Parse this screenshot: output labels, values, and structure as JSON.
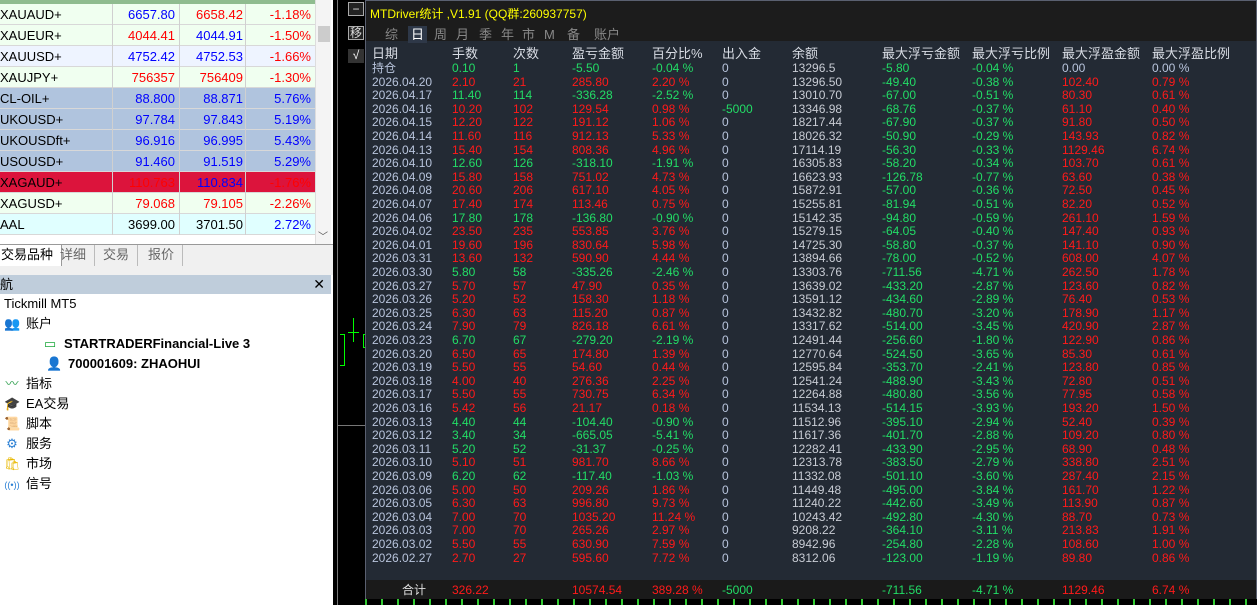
{
  "colors": {
    "profit": "#ff1a1a",
    "loss": "#22dd66",
    "neutral": "#b8c4dc",
    "balance": "#c8ccd4",
    "title": "#ffff00",
    "bid_up": "#0000ff",
    "bid_down": "#ff0000"
  },
  "market_watch": {
    "rows": [
      {
        "symbol": "XAUAUD+",
        "bid": "6657.80",
        "ask": "6658.42",
        "change": "-1.18%",
        "bg": "#f0fff0",
        "bid_color": "#0000ff",
        "ask_color": "#ff0000",
        "chg_color": "#ff0000"
      },
      {
        "symbol": "XAUEUR+",
        "bid": "4044.41",
        "ask": "4044.91",
        "change": "-1.50%",
        "bg": "#f0fff0",
        "bid_color": "#ff0000",
        "ask_color": "#0000ff",
        "chg_color": "#ff0000"
      },
      {
        "symbol": "XAUUSD+",
        "bid": "4752.42",
        "ask": "4752.53",
        "change": "-1.66%",
        "bg": "#eef4ff",
        "bid_color": "#0000ff",
        "ask_color": "#0000ff",
        "chg_color": "#ff0000"
      },
      {
        "symbol": "XAUJPY+",
        "bid": "756357",
        "ask": "756409",
        "change": "-1.30%",
        "bg": "#f0fff0",
        "bid_color": "#ff0000",
        "ask_color": "#ff0000",
        "chg_color": "#ff0000"
      },
      {
        "symbol": "CL-OIL+",
        "bid": "88.800",
        "ask": "88.871",
        "change": "5.76%",
        "bg": "#b0c4de",
        "bid_color": "#0000ff",
        "ask_color": "#0000ff",
        "chg_color": "#0000ff"
      },
      {
        "symbol": "UKOUSD+",
        "bid": "97.784",
        "ask": "97.843",
        "change": "5.19%",
        "bg": "#b0c4de",
        "bid_color": "#0000ff",
        "ask_color": "#0000ff",
        "chg_color": "#0000ff"
      },
      {
        "symbol": "UKOUSDft+",
        "bid": "96.916",
        "ask": "96.995",
        "change": "5.43%",
        "bg": "#b0c4de",
        "bid_color": "#0000ff",
        "ask_color": "#0000ff",
        "chg_color": "#0000ff"
      },
      {
        "symbol": "USOUSD+",
        "bid": "91.460",
        "ask": "91.519",
        "change": "5.29%",
        "bg": "#b0c4de",
        "bid_color": "#0000ff",
        "ask_color": "#0000ff",
        "chg_color": "#0000ff"
      },
      {
        "symbol": "XAGAUD+",
        "bid": "110.763",
        "ask": "110.834",
        "change": "-1.76%",
        "bg": "#dc143c",
        "bid_color": "#ff0000",
        "ask_color": "#0000ff",
        "chg_color": "#ff0000"
      },
      {
        "symbol": "XAGUSD+",
        "bid": "79.068",
        "ask": "79.105",
        "change": "-2.26%",
        "bg": "#f0fff0",
        "bid_color": "#ff0000",
        "ask_color": "#ff0000",
        "chg_color": "#ff0000"
      },
      {
        "symbol": "AAL",
        "bid": "3699.00",
        "ask": "3701.50",
        "change": "2.72%",
        "bg": "#e0ffff",
        "bid_color": "#000000",
        "ask_color": "#000000",
        "chg_color": "#0000ff"
      }
    ],
    "tabs": [
      "交易品种",
      "详细",
      "交易",
      "报价"
    ]
  },
  "navigator": {
    "title": "导航",
    "items": [
      {
        "label": "Tickmill MT5",
        "icon": "",
        "indent": 4,
        "bold": false
      },
      {
        "label": "账户",
        "icon": "accounts-icon",
        "glyph": "👥",
        "indent": 4,
        "bold": false
      },
      {
        "label": "STARTRADERFinancial-Live 3",
        "icon": "server-icon",
        "glyph": "▭",
        "indent": 42,
        "bold": true
      },
      {
        "label": "700001609: ZHAOHUI",
        "icon": "user-icon",
        "glyph": "👤",
        "indent": 46,
        "bold": true
      },
      {
        "label": "指标",
        "icon": "indicators-icon",
        "glyph": "〰",
        "indent": 4,
        "bold": false
      },
      {
        "label": "EA交易",
        "icon": "expert-advisor-icon",
        "glyph": "🎓",
        "indent": 4,
        "bold": false
      },
      {
        "label": "脚本",
        "icon": "script-icon",
        "glyph": "📜",
        "indent": 4,
        "bold": false
      },
      {
        "label": "服务",
        "icon": "services-icon",
        "glyph": "⚙",
        "indent": 4,
        "bold": false
      },
      {
        "label": "市场",
        "icon": "market-icon",
        "glyph": "🛍",
        "indent": 4,
        "bold": false
      },
      {
        "label": "信号",
        "icon": "signals-icon",
        "glyph": "((•))",
        "indent": 4,
        "bold": false
      }
    ]
  },
  "panel": {
    "title": "MTDriver统计 ,V1.91 (QQ群:260937757)",
    "controls": [
      "−",
      "移",
      "√"
    ],
    "tabs": [
      "综",
      "日",
      "周",
      "月",
      "季",
      "年",
      "市",
      "M",
      "备",
      "账户"
    ],
    "selected_tab": "日",
    "headers": [
      "日期",
      "手数",
      "次数",
      "盈亏金额",
      "百分比%",
      "出入金",
      "余额",
      "最大浮亏金额",
      "最大浮亏比例",
      "最大浮盈金额",
      "最大浮盈比例"
    ],
    "rows": [
      [
        "持仓",
        "0.10",
        "1",
        "-5.50",
        "-0.04 %",
        "0",
        "13296.5",
        "-5.80",
        "-0.04 %",
        "0.00",
        "0.00 %"
      ],
      [
        "2026.04.20",
        "2.10",
        "21",
        "285.80",
        "2.20 %",
        "0",
        "13296.50",
        "-49.40",
        "-0.38 %",
        "102.40",
        "0.79 %"
      ],
      [
        "2026.04.17",
        "11.40",
        "114",
        "-336.28",
        "-2.52 %",
        "0",
        "13010.70",
        "-67.00",
        "-0.51 %",
        "80.30",
        "0.61 %"
      ],
      [
        "2026.04.16",
        "10.20",
        "102",
        "129.54",
        "0.98 %",
        "-5000",
        "13346.98",
        "-68.76",
        "-0.37 %",
        "61.10",
        "0.40 %"
      ],
      [
        "2026.04.15",
        "12.20",
        "122",
        "191.12",
        "1.06 %",
        "0",
        "18217.44",
        "-67.90",
        "-0.37 %",
        "91.80",
        "0.50 %"
      ],
      [
        "2026.04.14",
        "11.60",
        "116",
        "912.13",
        "5.33 %",
        "0",
        "18026.32",
        "-50.90",
        "-0.29 %",
        "143.93",
        "0.82 %"
      ],
      [
        "2026.04.13",
        "15.40",
        "154",
        "808.36",
        "4.96 %",
        "0",
        "17114.19",
        "-56.30",
        "-0.33 %",
        "1129.46",
        "6.74 %"
      ],
      [
        "2026.04.10",
        "12.60",
        "126",
        "-318.10",
        "-1.91 %",
        "0",
        "16305.83",
        "-58.20",
        "-0.34 %",
        "103.70",
        "0.61 %"
      ],
      [
        "2026.04.09",
        "15.80",
        "158",
        "751.02",
        "4.73 %",
        "0",
        "16623.93",
        "-126.78",
        "-0.77 %",
        "63.60",
        "0.38 %"
      ],
      [
        "2026.04.08",
        "20.60",
        "206",
        "617.10",
        "4.05 %",
        "0",
        "15872.91",
        "-57.00",
        "-0.36 %",
        "72.50",
        "0.45 %"
      ],
      [
        "2026.04.07",
        "17.40",
        "174",
        "113.46",
        "0.75 %",
        "0",
        "15255.81",
        "-81.94",
        "-0.51 %",
        "82.20",
        "0.52 %"
      ],
      [
        "2026.04.06",
        "17.80",
        "178",
        "-136.80",
        "-0.90 %",
        "0",
        "15142.35",
        "-94.80",
        "-0.59 %",
        "261.10",
        "1.59 %"
      ],
      [
        "2026.04.02",
        "23.50",
        "235",
        "553.85",
        "3.76 %",
        "0",
        "15279.15",
        "-64.05",
        "-0.40 %",
        "147.40",
        "0.93 %"
      ],
      [
        "2026.04.01",
        "19.60",
        "196",
        "830.64",
        "5.98 %",
        "0",
        "14725.30",
        "-58.80",
        "-0.37 %",
        "141.10",
        "0.90 %"
      ],
      [
        "2026.03.31",
        "13.60",
        "132",
        "590.90",
        "4.44 %",
        "0",
        "13894.66",
        "-78.00",
        "-0.52 %",
        "608.00",
        "4.07 %"
      ],
      [
        "2026.03.30",
        "5.80",
        "58",
        "-335.26",
        "-2.46 %",
        "0",
        "13303.76",
        "-711.56",
        "-4.71 %",
        "262.50",
        "1.78 %"
      ],
      [
        "2026.03.27",
        "5.70",
        "57",
        "47.90",
        "0.35 %",
        "0",
        "13639.02",
        "-433.20",
        "-2.87 %",
        "123.60",
        "0.82 %"
      ],
      [
        "2026.03.26",
        "5.20",
        "52",
        "158.30",
        "1.18 %",
        "0",
        "13591.12",
        "-434.60",
        "-2.89 %",
        "76.40",
        "0.53 %"
      ],
      [
        "2026.03.25",
        "6.30",
        "63",
        "115.20",
        "0.87 %",
        "0",
        "13432.82",
        "-480.70",
        "-3.20 %",
        "178.90",
        "1.17 %"
      ],
      [
        "2026.03.24",
        "7.90",
        "79",
        "826.18",
        "6.61 %",
        "0",
        "13317.62",
        "-514.00",
        "-3.45 %",
        "420.90",
        "2.87 %"
      ],
      [
        "2026.03.23",
        "6.70",
        "67",
        "-279.20",
        "-2.19 %",
        "0",
        "12491.44",
        "-256.60",
        "-1.80 %",
        "122.90",
        "0.86 %"
      ],
      [
        "2026.03.20",
        "6.50",
        "65",
        "174.80",
        "1.39 %",
        "0",
        "12770.64",
        "-524.50",
        "-3.65 %",
        "85.30",
        "0.61 %"
      ],
      [
        "2026.03.19",
        "5.50",
        "55",
        "54.60",
        "0.44 %",
        "0",
        "12595.84",
        "-353.70",
        "-2.41 %",
        "123.80",
        "0.85 %"
      ],
      [
        "2026.03.18",
        "4.00",
        "40",
        "276.36",
        "2.25 %",
        "0",
        "12541.24",
        "-488.90",
        "-3.43 %",
        "72.80",
        "0.51 %"
      ],
      [
        "2026.03.17",
        "5.50",
        "55",
        "730.75",
        "6.34 %",
        "0",
        "12264.88",
        "-480.80",
        "-3.56 %",
        "77.95",
        "0.58 %"
      ],
      [
        "2026.03.16",
        "5.42",
        "56",
        "21.17",
        "0.18 %",
        "0",
        "11534.13",
        "-514.15",
        "-3.93 %",
        "193.20",
        "1.50 %"
      ],
      [
        "2026.03.13",
        "4.40",
        "44",
        "-104.40",
        "-0.90 %",
        "0",
        "11512.96",
        "-395.10",
        "-2.94 %",
        "52.40",
        "0.39 %"
      ],
      [
        "2026.03.12",
        "3.40",
        "34",
        "-665.05",
        "-5.41 %",
        "0",
        "11617.36",
        "-401.70",
        "-2.88 %",
        "109.20",
        "0.80 %"
      ],
      [
        "2026.03.11",
        "5.20",
        "52",
        "-31.37",
        "-0.25 %",
        "0",
        "12282.41",
        "-433.90",
        "-2.95 %",
        "68.90",
        "0.48 %"
      ],
      [
        "2026.03.10",
        "5.10",
        "51",
        "981.70",
        "8.66 %",
        "0",
        "12313.78",
        "-383.50",
        "-2.79 %",
        "338.80",
        "2.51 %"
      ],
      [
        "2026.03.09",
        "6.20",
        "62",
        "-117.40",
        "-1.03 %",
        "0",
        "11332.08",
        "-501.10",
        "-3.60 %",
        "287.40",
        "2.15 %"
      ],
      [
        "2026.03.06",
        "5.00",
        "50",
        "209.26",
        "1.86 %",
        "0",
        "11449.48",
        "-495.00",
        "-3.84 %",
        "161.70",
        "1.22 %"
      ],
      [
        "2026.03.05",
        "6.30",
        "63",
        "996.80",
        "9.73 %",
        "0",
        "11240.22",
        "-442.60",
        "-3.49 %",
        "113.90",
        "0.87 %"
      ],
      [
        "2026.03.04",
        "7.00",
        "70",
        "1035.20",
        "11.24 %",
        "0",
        "10243.42",
        "-492.80",
        "-4.30 %",
        "88.70",
        "0.73 %"
      ],
      [
        "2026.03.03",
        "7.00",
        "70",
        "265.26",
        "2.97 %",
        "0",
        "9208.22",
        "-364.10",
        "-3.11 %",
        "213.83",
        "1.91 %"
      ],
      [
        "2026.03.02",
        "5.50",
        "55",
        "630.90",
        "7.59 %",
        "0",
        "8942.96",
        "-254.80",
        "-2.28 %",
        "108.60",
        "1.00 %"
      ],
      [
        "2026.02.27",
        "2.70",
        "27",
        "595.60",
        "7.72 %",
        "0",
        "8312.06",
        "-123.00",
        "-1.19 %",
        "89.80",
        "0.86 %"
      ]
    ],
    "total": [
      "合计",
      "326.22",
      "",
      "10574.54",
      "389.28 %",
      "-5000",
      "",
      "-711.56",
      "-4.71 %",
      "1129.46",
      "6.74 %"
    ]
  }
}
